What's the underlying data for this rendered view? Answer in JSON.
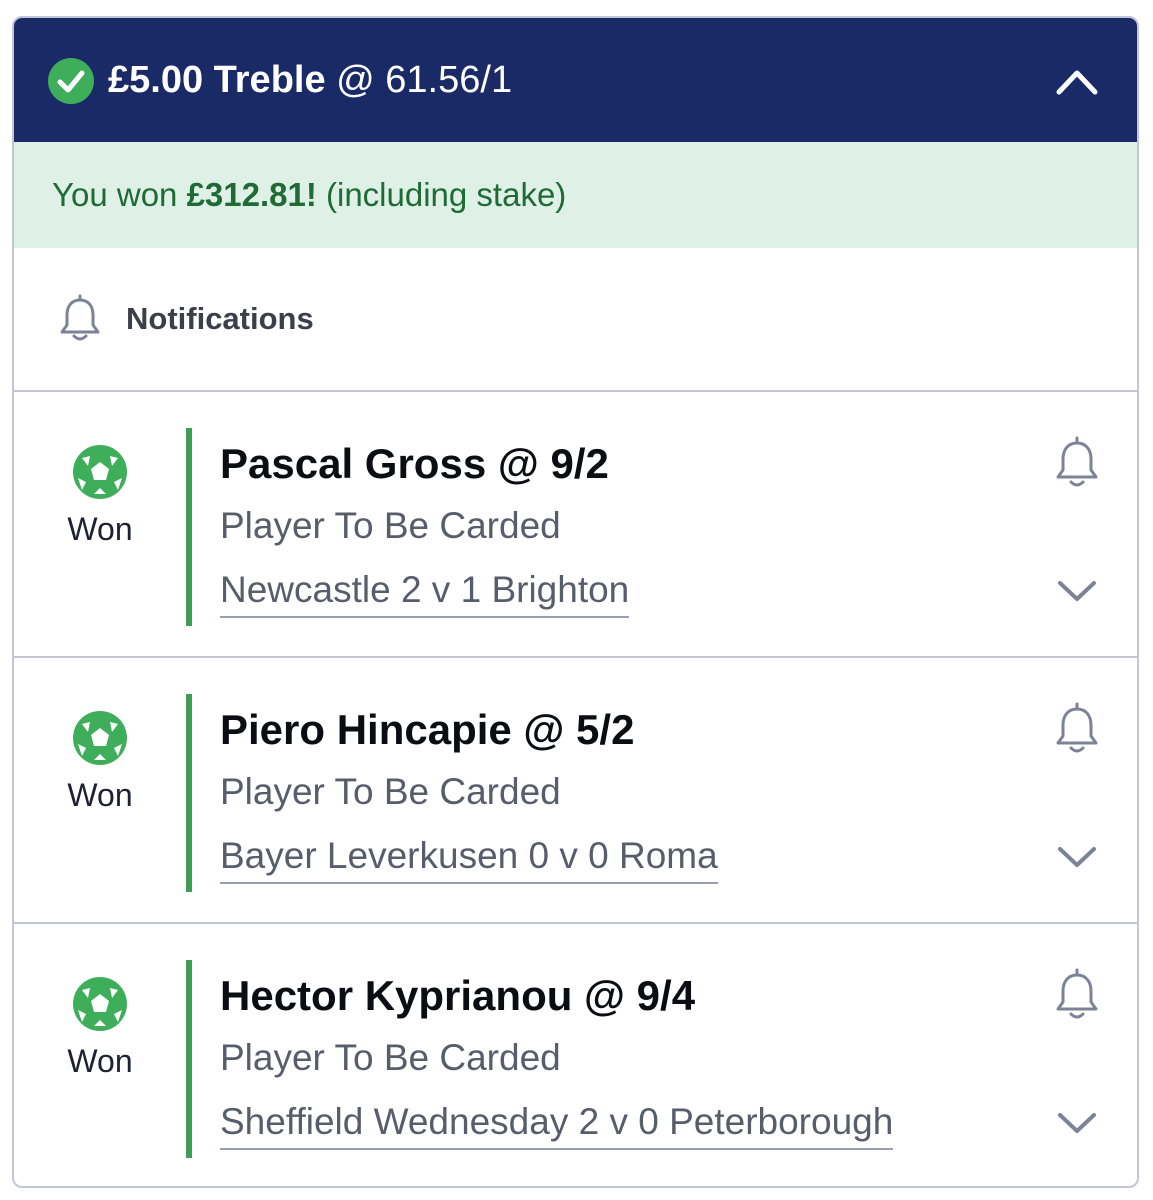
{
  "header": {
    "stake_label": "£5.00 Treble",
    "odds_label": "@ 61.56/1",
    "status_icon": "check-circle-icon",
    "toggle_icon": "chevron-up-icon"
  },
  "result_banner": {
    "prefix": "You won ",
    "amount": "£312.81!",
    "suffix": " (including stake)"
  },
  "notifications": {
    "label": "Notifications",
    "icon": "bell-icon"
  },
  "selections": [
    {
      "title": "Pascal Gross @ 9/2",
      "market": "Player To Be Carded",
      "event": "Newcastle 2 v 1 Brighton",
      "status": "Won"
    },
    {
      "title": "Piero Hincapie @ 5/2",
      "market": "Player To Be Carded",
      "event": "Bayer Leverkusen 0 v 0 Roma",
      "status": "Won"
    },
    {
      "title": "Hector Kyprianou @ 9/4",
      "market": "Player To Be Carded",
      "event": "Sheffield Wednesday 2 v 0 Peterborough",
      "status": "Won"
    }
  ],
  "colors": {
    "header_bg": "#1a2a66",
    "won_banner_bg": "#dff0e6",
    "won_text": "#1e6b36",
    "accent_green": "#3f9e55",
    "border": "#c3c7d3"
  }
}
